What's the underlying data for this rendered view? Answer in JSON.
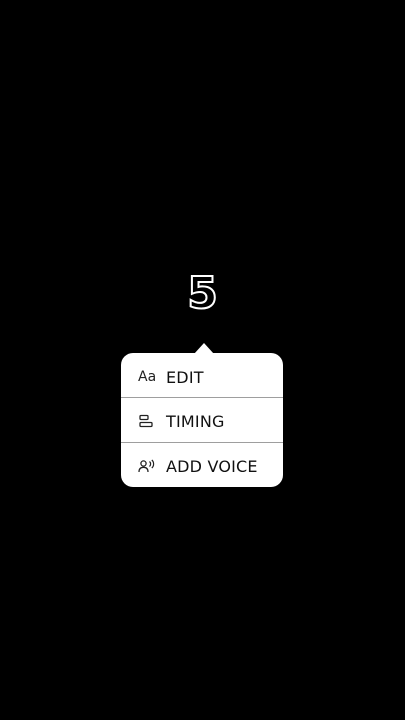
{
  "overlay": {
    "text": "5"
  },
  "menu": {
    "items": [
      {
        "icon": "text-format-icon",
        "icon_glyph": "Aa",
        "label": "EDIT"
      },
      {
        "icon": "timing-icon",
        "label": "TIMING"
      },
      {
        "icon": "voice-icon",
        "label": "ADD VOICE"
      }
    ]
  },
  "colors": {
    "background": "#000000",
    "menu_background": "#ffffff",
    "text_outline": "#ffffff"
  }
}
